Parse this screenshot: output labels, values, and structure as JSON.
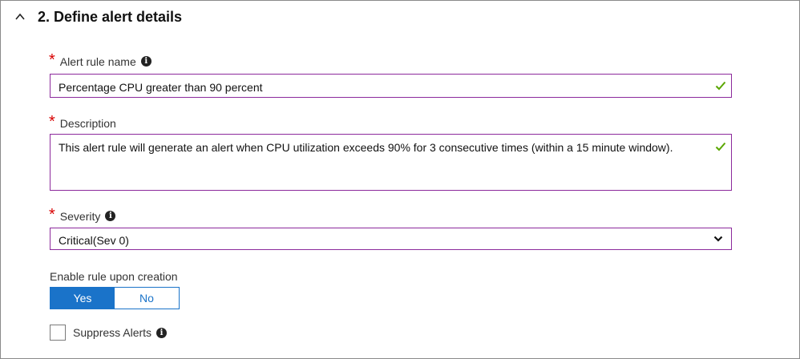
{
  "section": {
    "title": "2. Define alert details"
  },
  "fields": {
    "rule_name": {
      "label": "Alert rule name",
      "value": "Percentage CPU greater than 90 percent"
    },
    "description": {
      "label": "Description",
      "value": "This alert rule will generate an alert when CPU utilization exceeds 90% for 3 consecutive times (within a 15 minute window)."
    },
    "severity": {
      "label": "Severity",
      "value": "Critical(Sev 0)"
    }
  },
  "enable": {
    "label": "Enable rule upon creation",
    "yes": "Yes",
    "no": "No",
    "selected": "Yes"
  },
  "suppress": {
    "label": "Suppress Alerts",
    "checked": false
  },
  "required_mark": "*",
  "info_glyph": "i",
  "colors": {
    "accent": "#1a73c9",
    "field_border": "#8c2a9c",
    "valid_check": "#5aa700",
    "required": "#d80000"
  }
}
